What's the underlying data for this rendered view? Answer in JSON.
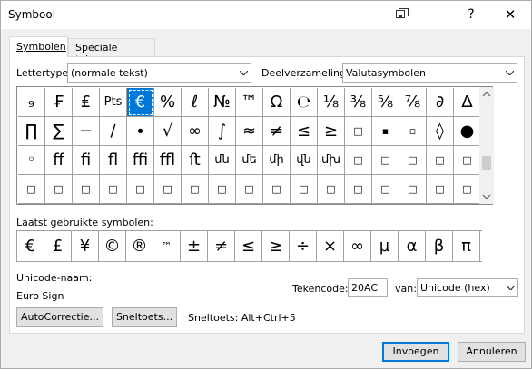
{
  "window": {
    "title": "Symbool",
    "help_label": "?",
    "close_label": "✕"
  },
  "tabs": [
    {
      "label": "Symbolen",
      "active": true
    },
    {
      "label": "Speciale tekens",
      "active": false
    }
  ],
  "font": {
    "label": "Lettertype:",
    "value": "(normale tekst)"
  },
  "subset": {
    "label": "Deelverzameling:",
    "value": "Valutasymbolen"
  },
  "symbols": [
    [
      "₉",
      "₣",
      "₤",
      "Pts",
      "€",
      "%",
      "ℓ",
      "№",
      "™",
      "Ω",
      "℮",
      "⅛",
      "⅜",
      "⅝",
      "⅞",
      "∂",
      "∆"
    ],
    [
      "∏",
      "∑",
      "−",
      "∕",
      "∙",
      "√",
      "∞",
      "∫",
      "≈",
      "≠",
      "≤",
      "≥",
      "□",
      "▪",
      "▫",
      "◊",
      "●"
    ],
    [
      "◦",
      "ﬀ",
      "ﬁ",
      "ﬂ",
      "ﬃ",
      "ﬄ",
      "ﬅ",
      "մն",
      "մե",
      "մի",
      "վն",
      "մխ",
      "□",
      "□",
      "□",
      "□",
      "□"
    ],
    [
      "□",
      "□",
      "□",
      "□",
      "□",
      "□",
      "□",
      "□",
      "□",
      "□",
      "□",
      "□",
      "□",
      "□",
      "□",
      "□",
      "□"
    ]
  ],
  "selected_symbol": "€",
  "recent": {
    "label": "Laatst gebruikte symbolen:",
    "items": [
      "€",
      "£",
      "¥",
      "©",
      "®",
      "™",
      "±",
      "≠",
      "≤",
      "≥",
      "÷",
      "×",
      "∞",
      "µ",
      "α",
      "β",
      "π"
    ]
  },
  "unicode_name": {
    "label": "Unicode-naam:",
    "value": "Euro Sign"
  },
  "charcode": {
    "label": "Tekencode:",
    "value": "20AC"
  },
  "from": {
    "label": "van:",
    "value": "Unicode (hex)"
  },
  "buttons": {
    "autocorrect": "AutoCorrectie...",
    "shortcut_key": "Sneltoets...",
    "insert": "Invoegen",
    "cancel": "Annuleren"
  },
  "shortcut_text": "Sneltoets: Alt+Ctrl+5",
  "colors": {
    "selection": "#0078d7",
    "primary_border": "#0078d7"
  }
}
